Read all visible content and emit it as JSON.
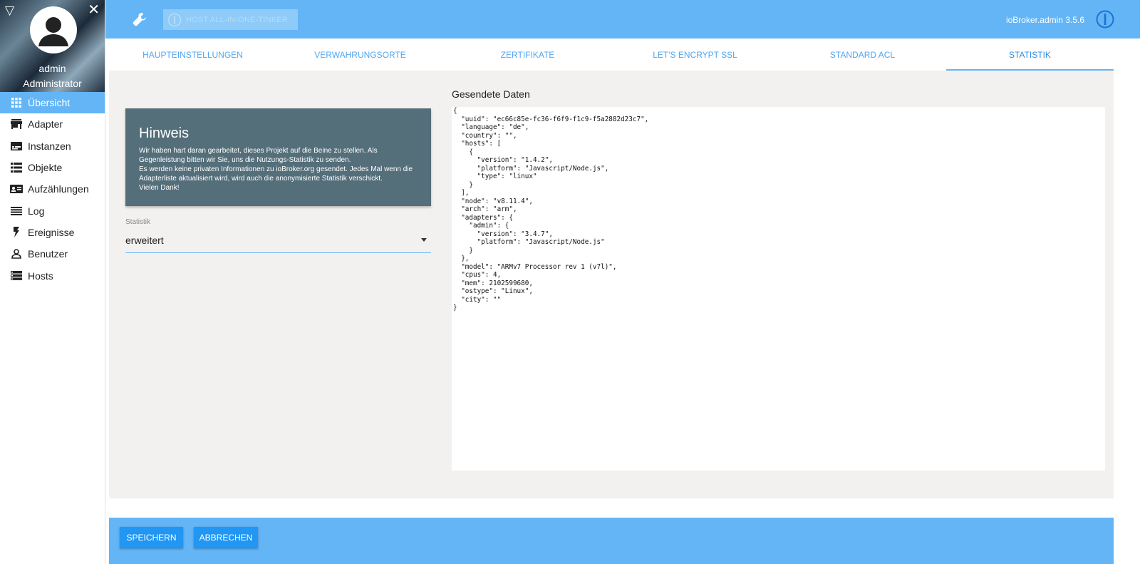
{
  "sidebar": {
    "username": "admin",
    "role": "Administrator",
    "items": [
      {
        "label": "Übersicht",
        "icon": "grid-icon"
      },
      {
        "label": "Adapter",
        "icon": "store-icon"
      },
      {
        "label": "Instanzen",
        "icon": "instances-icon"
      },
      {
        "label": "Objekte",
        "icon": "list-icon"
      },
      {
        "label": "Aufzählungen",
        "icon": "enum-icon"
      },
      {
        "label": "Log",
        "icon": "log-icon"
      },
      {
        "label": "Ereignisse",
        "icon": "flash-icon"
      },
      {
        "label": "Benutzer",
        "icon": "person-icon"
      },
      {
        "label": "Hosts",
        "icon": "hosts-icon"
      }
    ]
  },
  "header": {
    "host_label": "HOST ALL-IN-ONE-TINKER",
    "version": "ioBroker.admin 3.5.6"
  },
  "tabs": [
    {
      "label": "HAUPTEINSTELLUNGEN"
    },
    {
      "label": "VERWAHRUNGSORTE"
    },
    {
      "label": "ZERTIFIKATE"
    },
    {
      "label": "LET'S ENCRYPT SSL"
    },
    {
      "label": "STANDARD ACL"
    },
    {
      "label": "STATISTIK"
    }
  ],
  "hinweis": {
    "title": "Hinweis",
    "line1": "Wir haben hart daran gearbeitet, dieses Projekt auf die Beine zu stellen. Als",
    "line2": "Gegenleistung bitten wir Sie, uns die Nutzungs-Statistik zu senden.",
    "line3": "Es werden keine privaten Informationen zu ioBroker.org gesendet. Jedes Mal wenn die",
    "line4": "Adapterliste aktualisiert wird, wird auch die anonymisierte Statistik verschickt.",
    "line5": "Vielen Dank!"
  },
  "statistik": {
    "label": "Statistik",
    "value": "erweitert"
  },
  "sent_data": {
    "title": "Gesendete Daten",
    "json": "{\n  \"uuid\": \"ec66c85e-fc36-f6f9-f1c9-f5a2882d23c7\",\n  \"language\": \"de\",\n  \"country\": \"\",\n  \"hosts\": [\n    {\n      \"version\": \"1.4.2\",\n      \"platform\": \"Javascript/Node.js\",\n      \"type\": \"linux\"\n    }\n  ],\n  \"node\": \"v8.11.4\",\n  \"arch\": \"arm\",\n  \"adapters\": {\n    \"admin\": {\n      \"version\": \"3.4.7\",\n      \"platform\": \"Javascript/Node.js\"\n    }\n  },\n  \"model\": \"ARMv7 Processor rev 1 (v7l)\",\n  \"cpus\": 4,\n  \"mem\": 2102599680,\n  \"ostype\": \"Linux\",\n  \"city\": \"\"\n}"
  },
  "footer": {
    "save_label": "SPEICHERN",
    "cancel_label": "ABBRECHEN"
  },
  "colors": {
    "accent": "#64b5f6",
    "button": "#2196f3",
    "hinweis_bg": "#546e7a",
    "main_bg": "#f3f1ef"
  }
}
